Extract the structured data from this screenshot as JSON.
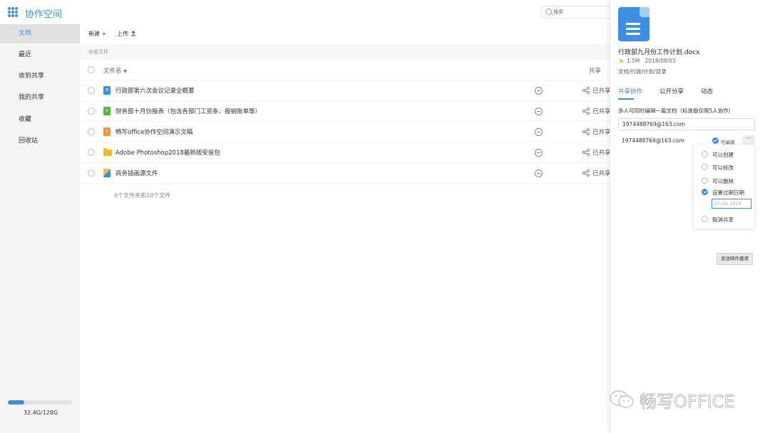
{
  "app": {
    "title": "协作空间"
  },
  "search": {
    "placeholder": "搜索"
  },
  "sidebar": {
    "items": [
      {
        "label": "文档",
        "active": true
      },
      {
        "label": "最近"
      },
      {
        "label": "收到共享"
      },
      {
        "label": "我的共享"
      },
      {
        "label": "收藏"
      },
      {
        "label": "回收站"
      }
    ],
    "storage": {
      "text": "32.4G/128G",
      "used_fraction": 0.25
    }
  },
  "toolbar": {
    "new_label": "新建 +",
    "upload_label": "上传"
  },
  "breadcrumb": "全部文件",
  "list": {
    "header_name": "文件名",
    "header_share": "共享",
    "rows": [
      {
        "name": "行政部第六次会议记录全概要",
        "type": "word",
        "icon_letter": "W",
        "share": "已共享"
      },
      {
        "name": "财务部十月份报表（包含各部门工资条、报销账单等）",
        "type": "excel",
        "icon_letter": "X",
        "share": "已共享"
      },
      {
        "name": "畅写office协作空间演示文稿",
        "type": "ppt",
        "icon_letter": "P",
        "share": "已共享"
      },
      {
        "name": "Adobe Photoshop2018最新版安装包",
        "type": "folder",
        "icon_letter": "",
        "share": "已共享"
      },
      {
        "name": "商务插画源文件",
        "type": "img",
        "icon_letter": "",
        "share": "已共享"
      }
    ],
    "count_text": "6个文件夹和10个文件"
  },
  "panel": {
    "file_title": "行政部九月份工作计划.docx",
    "size": "1.5M",
    "date": "2018/08/03",
    "path": "文档/行政/计划/目录",
    "tabs": [
      "共享协作",
      "公开分享",
      "动态"
    ],
    "collab_note": "多人可同时编辑一篇文档（标准版仅限5人协作）",
    "email_input_value": "1974488769@163.com",
    "member_email": "1974488769@163.com",
    "member_perm": "可编辑",
    "more_label": "···",
    "dropdown": [
      {
        "label": "可以创建",
        "checked": false
      },
      {
        "label": "可以修改",
        "checked": false
      },
      {
        "label": "可以删除",
        "checked": false
      },
      {
        "label": "设置过期日期",
        "checked": true
      },
      {
        "label": "取消共享",
        "checked": false
      }
    ],
    "date_placeholder": "07-09-2018",
    "send_button": "发送邮件邀请"
  },
  "watermark": "畅写OFFICE",
  "colors": {
    "accent": "#3a8ee6",
    "word": "#3a8ee6",
    "excel": "#52b83a",
    "ppt": "#f5963c",
    "folder": "#f5b82e"
  }
}
